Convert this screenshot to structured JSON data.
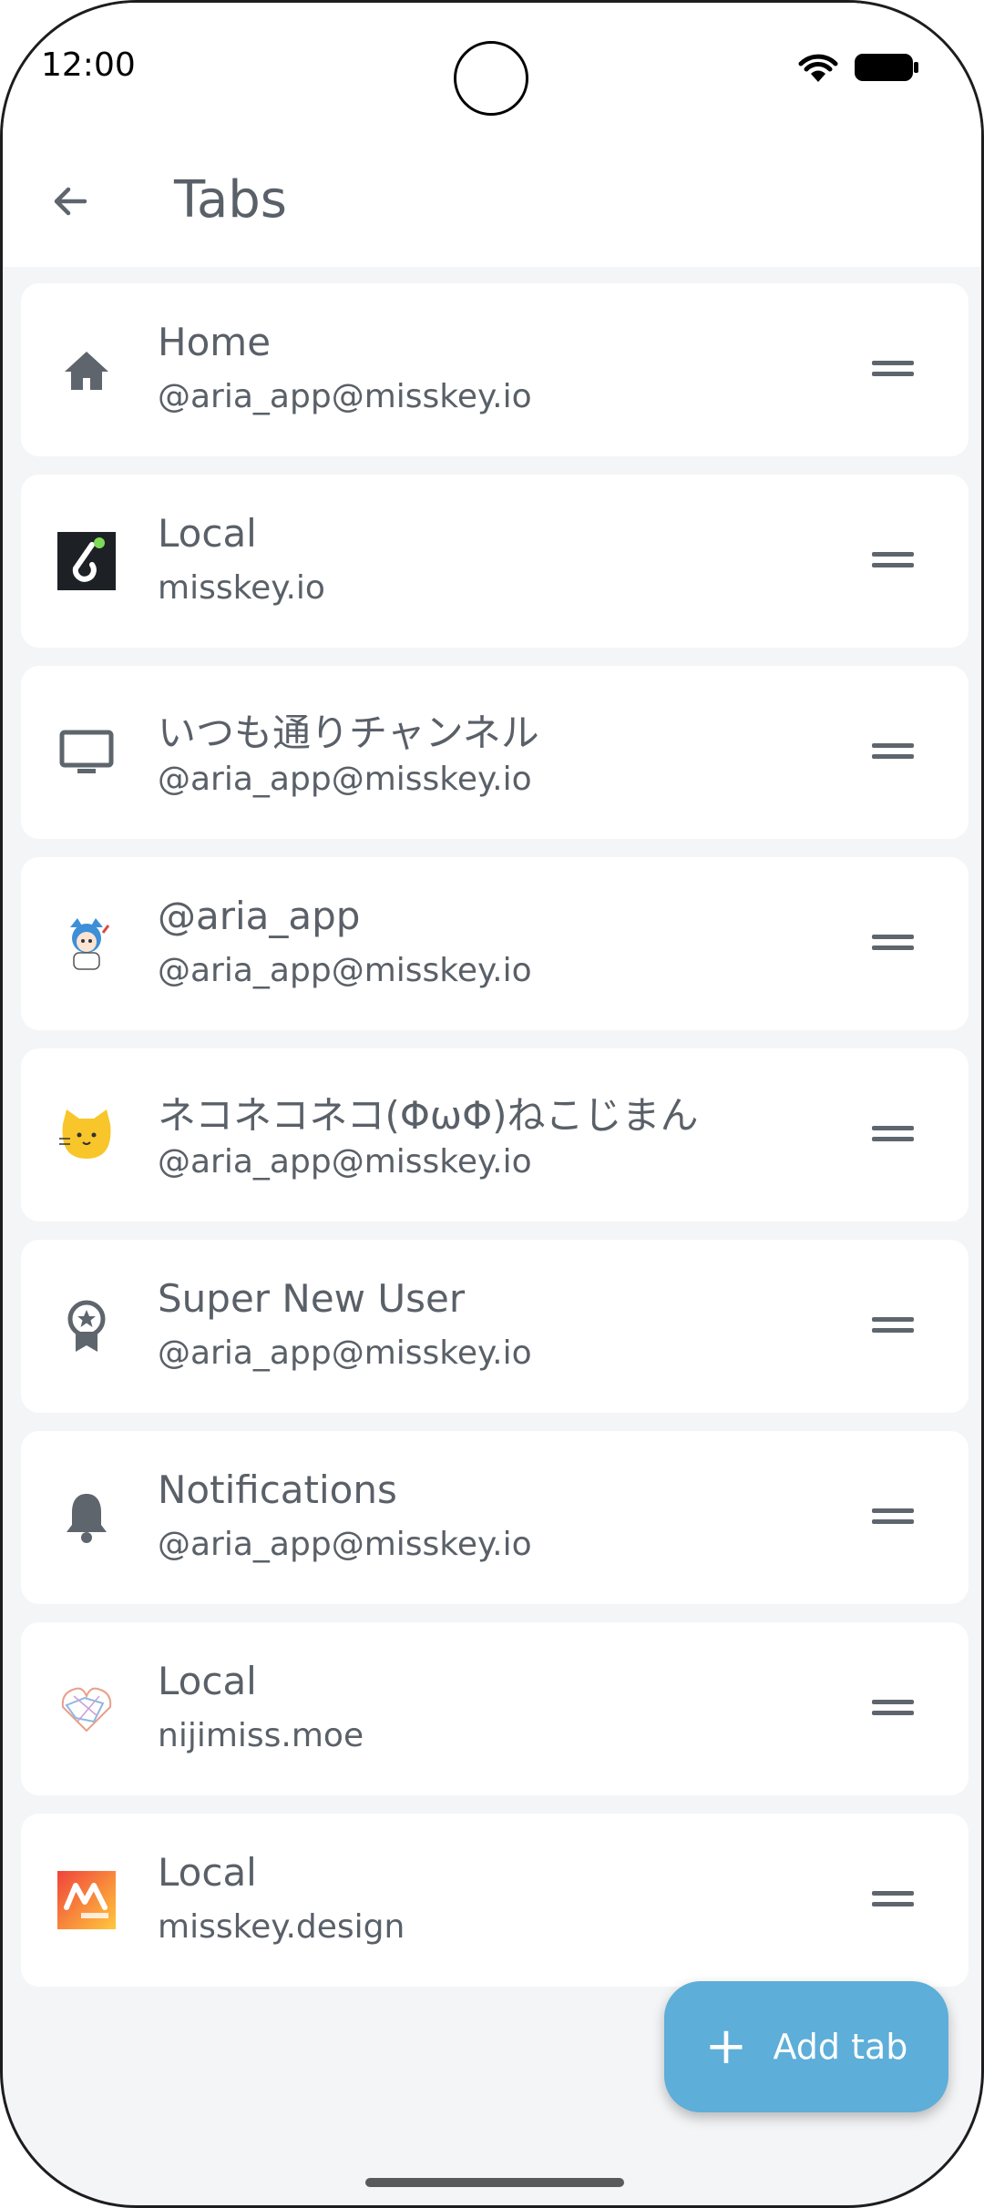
{
  "status_bar": {
    "time": "12:00"
  },
  "header": {
    "title": "Tabs",
    "back_icon": "arrow-back-icon"
  },
  "tabs": [
    {
      "title": "Home",
      "subtitle": "@aria_app@misskey.io",
      "icon": "home-icon"
    },
    {
      "title": "Local",
      "subtitle": "misskey.io",
      "icon": "misskey-io-logo"
    },
    {
      "title": "いつも通りチャンネル",
      "subtitle": "@aria_app@misskey.io",
      "icon": "tv-icon"
    },
    {
      "title": "@aria_app",
      "subtitle": "@aria_app@misskey.io",
      "icon": "user-avatar"
    },
    {
      "title": "ネコネコネコ(ΦωΦ)ねこじまん",
      "subtitle": "@aria_app@misskey.io",
      "icon": "cat-icon"
    },
    {
      "title": "Super New User",
      "subtitle": "@aria_app@misskey.io",
      "icon": "badge-icon"
    },
    {
      "title": "Notifications",
      "subtitle": "@aria_app@misskey.io",
      "icon": "bell-icon"
    },
    {
      "title": "Local",
      "subtitle": "nijimiss.moe",
      "icon": "nijimiss-logo"
    },
    {
      "title": "Local",
      "subtitle": "misskey.design",
      "icon": "misskey-design-logo"
    }
  ],
  "fab": {
    "label": "Add tab",
    "icon": "plus-icon"
  },
  "colors": {
    "background": "#f4f5f7",
    "card": "#ffffff",
    "text": "#5a6068",
    "fab": "#5daed9"
  }
}
